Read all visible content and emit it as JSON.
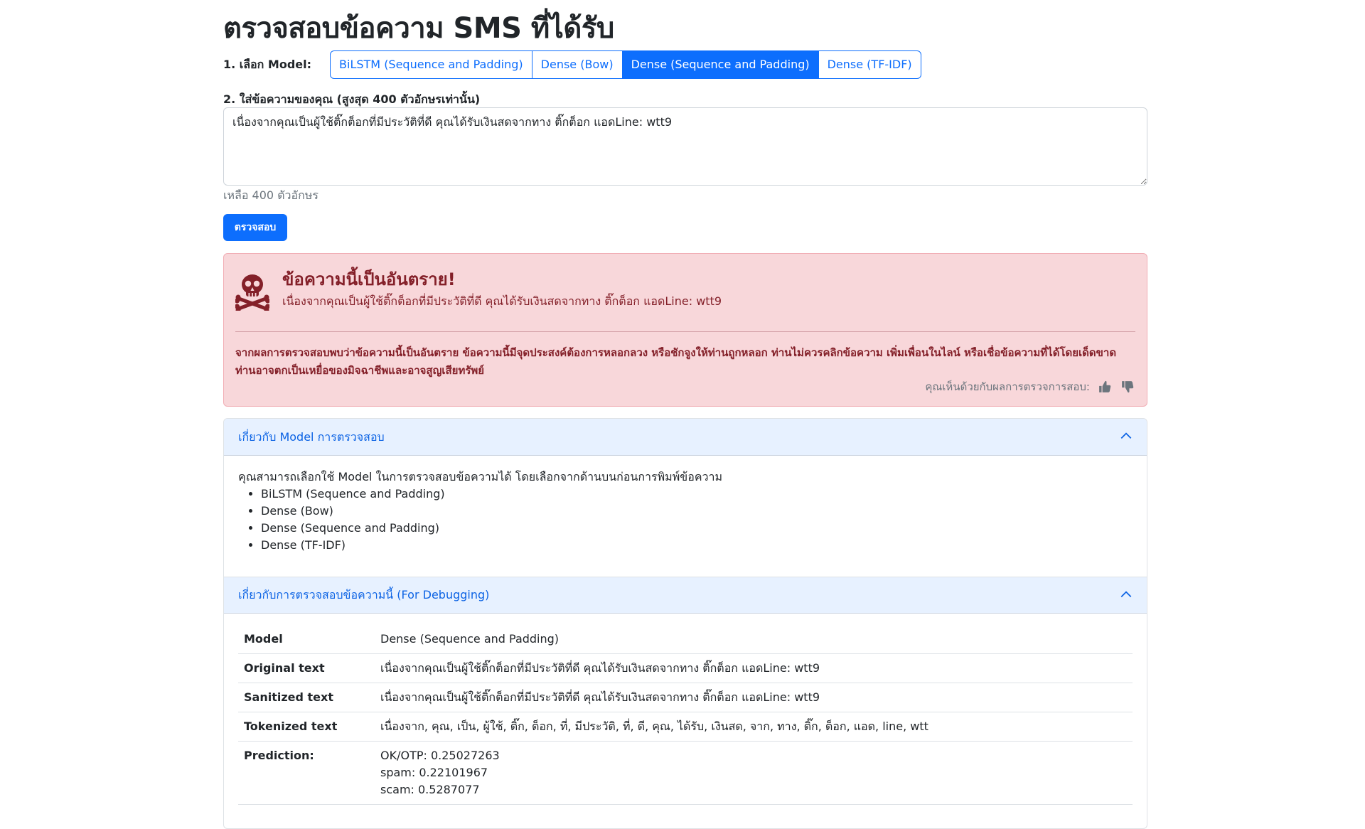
{
  "page_title": "ตรวจสอบข้อความ SMS ที่ได้รับ",
  "model_select": {
    "label": "1. เลือก Model:",
    "options": [
      "BiLSTM (Sequence and Padding)",
      "Dense (Bow)",
      "Dense (Sequence and Padding)",
      "Dense (TF-IDF)"
    ],
    "selected": "Dense (Sequence and Padding)"
  },
  "message": {
    "label": "2. ใส่ข้อความของคุณ (สูงสุด 400 ตัวอักษรเท่านั้น)",
    "value": "เนื่องจากคุณเป็นผู้ใช้ติ๊กต็อกที่มีประวัติที่ดี คุณได้รับเงินสดจากทาง ติ๊กต็อก แอดLine: wtt9",
    "char_count": "เหลือ 400 ตัวอักษร"
  },
  "check_button": "ตรวจสอบ",
  "result_alert": {
    "title": "ข้อความนี้เป็นอันตราย!",
    "message": "เนื่องจากคุณเป็นผู้ใช้ติ๊กต็อกที่มีประวัติที่ดี คุณได้รับเงินสดจากทาง ติ๊กต็อก แอดLine: wtt9",
    "description": "จากผลการตรวจสอบพบว่าข้อความนี้เป็นอันตราย ข้อความนี้มีจุดประสงค์ต้องการหลอกลวง หรือชักจูงให้ท่านถูกหลอก ท่านไม่ควรคลิกข้อความ เพิ่มเพื่อนในไลน์ หรือเชื่อข้อความที่ได้โดยเด็ดขาด ท่านอาจตกเป็นเหยื่อของมิจฉาชีพและอาจสูญเสียทรัพย์",
    "feedback_label": "คุณเห็นด้วยกับผลการตรวจการสอบ:",
    "color": "#842029",
    "background": "#f8d7da"
  },
  "accordion": {
    "about_model": {
      "header": "เกี่ยวกับ Model การตรวจสอบ",
      "intro": "คุณสามารถเลือกใช้ Model ในการตรวจสอบข้อความได้ โดยเลือกจากด้านบนก่อนการพิมพ์ข้อความ",
      "models": [
        "BiLSTM (Sequence and Padding)",
        "Dense (Bow)",
        "Dense (Sequence and Padding)",
        "Dense (TF-IDF)"
      ]
    },
    "debug": {
      "header": "เกี่ยวกับการตรวจสอบข้อความนี้ (For Debugging)",
      "rows": [
        {
          "key": "Model",
          "value": "Dense (Sequence and Padding)"
        },
        {
          "key": "Original text",
          "value": "เนื่องจากคุณเป็นผู้ใช้ติ๊กต็อกที่มีประวัติที่ดี คุณได้รับเงินสดจากทาง ติ๊กต็อก แอดLine: wtt9"
        },
        {
          "key": "Sanitized text",
          "value": "เนื่องจากคุณเป็นผู้ใช้ติ๊กต็อกที่มีประวัติที่ดี คุณได้รับเงินสดจากทาง ติ๊กต็อก แอดLine: wtt9"
        },
        {
          "key": "Tokenized text",
          "value": "เนื่องจาก, คุณ, เป็น, ผู้ใช้, ติ๊ก, ต็อก, ที่, มีประวัติ, ที่, ดี, คุณ, ได้รับ, เงินสด, จาก, ทาง, ติ๊ก, ต็อก, แอด, line, wtt"
        }
      ],
      "prediction": {
        "key": "Prediction:",
        "lines": [
          "OK/OTP: 0.25027263",
          "spam: 0.22101967",
          "scam: 0.5287077"
        ]
      }
    }
  },
  "colors": {
    "primary": "#0d6efd",
    "accordion_header_bg": "#e7f1ff",
    "accordion_header_text": "#0c63e4"
  }
}
